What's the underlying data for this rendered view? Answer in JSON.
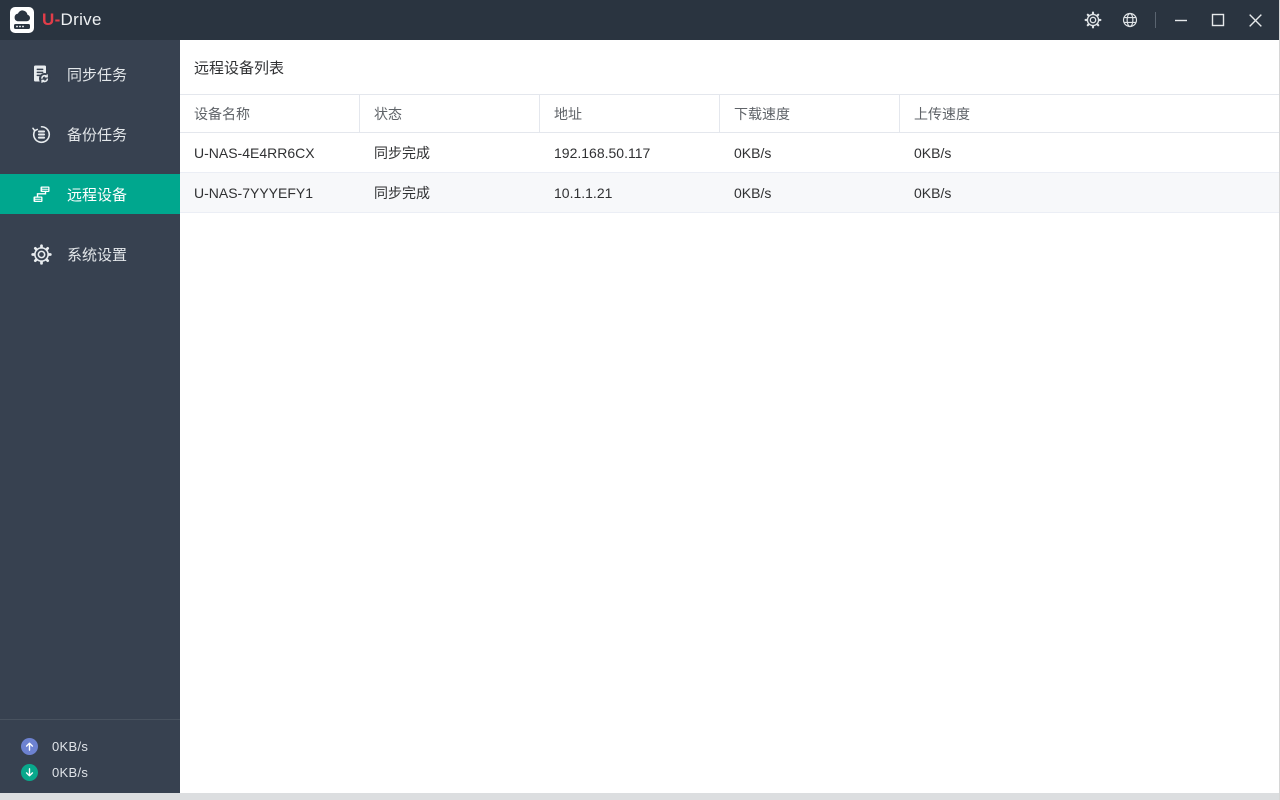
{
  "app": {
    "brand_prefix": "U-",
    "brand_suffix": "Drive"
  },
  "titlebar": {
    "icons": [
      "settings-gear",
      "language-globe",
      "minimize",
      "maximize",
      "close"
    ]
  },
  "sidebar": {
    "items": [
      {
        "label": "同步任务",
        "icon": "sync-task-icon",
        "active": false
      },
      {
        "label": "备份任务",
        "icon": "backup-task-icon",
        "active": false
      },
      {
        "label": "远程设备",
        "icon": "remote-device-icon",
        "active": true
      },
      {
        "label": "系统设置",
        "icon": "system-settings-icon",
        "active": false
      }
    ],
    "footer": {
      "upload_speed": "0KB/s",
      "download_speed": "0KB/s"
    }
  },
  "main": {
    "title": "远程设备列表",
    "table": {
      "columns": [
        "设备名称",
        "状态",
        "地址",
        "下载速度",
        "上传速度"
      ],
      "rows": [
        [
          "U-NAS-4E4RR6CX",
          "同步完成",
          "192.168.50.117",
          "0KB/s",
          "0KB/s"
        ],
        [
          "U-NAS-7YYYEFY1",
          "同步完成",
          "10.1.1.21",
          "0KB/s",
          "0KB/s"
        ]
      ]
    }
  },
  "colors": {
    "titlebar_bg": "#2a3440",
    "sidebar_bg": "#374150",
    "accent_teal": "#00a78e",
    "brand_red": "#e23d49",
    "upload_circle": "#6d82d1",
    "download_circle": "#09a88c",
    "table_border": "#e4e7ed",
    "row_stripe": "#f7f8fa",
    "text_dark": "#303133",
    "text_header": "#5f6368"
  }
}
